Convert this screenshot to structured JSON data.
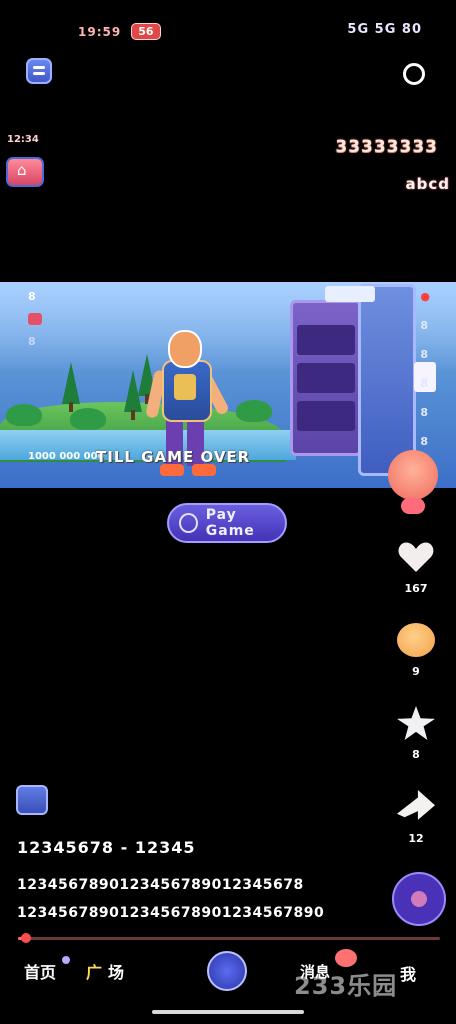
{
  "status_bar": {
    "time": "19:59",
    "pill": "56",
    "right": "5G 5G 80"
  },
  "top": {
    "left_count": "12:34",
    "right_title": "33333333",
    "right_sub": "abcd"
  },
  "scene": {
    "caption": "1000 000 000",
    "title_overlay": "TILL GAME OVER",
    "hud": [
      "8",
      "8"
    ],
    "right_dots": [
      "●",
      "8",
      "8",
      "8",
      "8",
      "8"
    ]
  },
  "play_pill": {
    "label": "Pay Game"
  },
  "rail": {
    "likes": "167",
    "comments": "9",
    "favorites": "8",
    "shares": "12"
  },
  "post": {
    "author": "12345678 - 12345",
    "desc_line1": "1234567890123456789012345678",
    "desc_line2": "123456789012345678901234567890"
  },
  "progress": {
    "fraction": 0.02
  },
  "nav": {
    "home": "首页",
    "plaza_first": "广",
    "plaza_rest": "场",
    "messages": "消息",
    "me": "我"
  },
  "watermark": "233乐园",
  "colors": {
    "accent": "#4333b6",
    "progress": "#ff6a6a",
    "plaza": "#ffd95e"
  }
}
